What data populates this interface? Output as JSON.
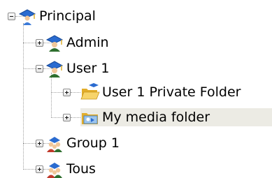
{
  "tree": {
    "root": {
      "label": "Principal",
      "icon": "user-icon",
      "expanded": true
    },
    "admin": {
      "label": "Admin",
      "icon": "user-icon",
      "expanded": false
    },
    "user1": {
      "label": "User 1",
      "icon": "user-icon",
      "expanded": true
    },
    "private_folder": {
      "label": "User 1 Private Folder",
      "icon": "open-folder-icon",
      "expanded": false
    },
    "media_folder": {
      "label": "My media folder",
      "icon": "media-folder-icon",
      "expanded": false,
      "selected": true
    },
    "group1": {
      "label": "Group 1",
      "icon": "group-icon",
      "expanded": false
    },
    "tous": {
      "label": "Tous",
      "icon": "group-icon",
      "expanded": false
    }
  },
  "colors": {
    "selection_bg": "#ecebe4",
    "tree_lines": "#a0a0a0",
    "user_cap": "#2a6bd0",
    "folder": "#f2c64c"
  }
}
